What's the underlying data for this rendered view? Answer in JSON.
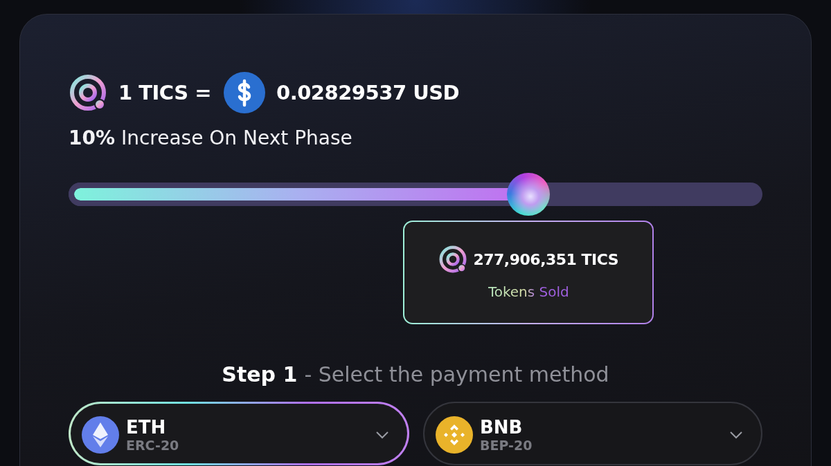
{
  "rate": {
    "token": "1 TICS =",
    "price": "0.02829537 USD"
  },
  "increase": "**10%** Increase On Next Phase",
  "progress": {
    "level": 0.663
  },
  "tooltip": {
    "amount": "277,906,351 TICS",
    "caption": "Tokens Sold"
  },
  "step": {
    "number": "Step 1",
    "text": "- Select the payment method"
  },
  "payment_methods": [
    {
      "kind": "eth",
      "name": "ETH",
      "network": "ERC-20",
      "selected": true
    },
    {
      "kind": "bnb",
      "name": "BNB",
      "network": "BEP-20",
      "selected": false
    }
  ]
}
